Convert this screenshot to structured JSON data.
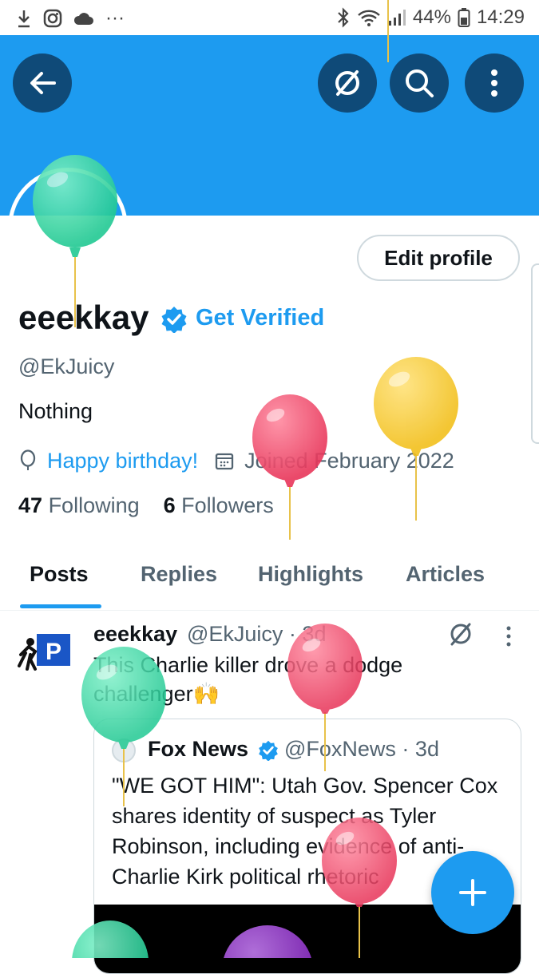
{
  "status_bar": {
    "battery": "44%",
    "time": "14:29"
  },
  "profile": {
    "name": "eeekkay",
    "get_verified": "Get Verified",
    "handle": "@EkJuicy",
    "bio": "Nothing",
    "birthday_link": "Happy birthday!",
    "joined": "Joined February 2022",
    "following_count": "47",
    "following_label": "Following",
    "followers_count": "6",
    "followers_label": "Followers",
    "edit_profile": "Edit profile"
  },
  "tabs": [
    {
      "label": "Posts",
      "active": true
    },
    {
      "label": "Replies"
    },
    {
      "label": "Highlights"
    },
    {
      "label": "Articles"
    }
  ],
  "post": {
    "author_name": "eeekkay",
    "author_handle_time": "@EkJuicy · 3d",
    "text": "This Charlie killer drove a dodge challenger🙌",
    "quote": {
      "author_name": "Fox News",
      "author_handle_time": "@FoxNews · 3d",
      "text": "\"WE GOT HIM\": Utah Gov. Spencer Cox shares identity of suspect as Tyler Robinson, including evidence of anti-Charlie Kirk political rhetoric"
    }
  },
  "colors": {
    "accent": "#1d9bf0",
    "button_dark": "#0f4a78",
    "balloon_green": "#3ddba0",
    "balloon_pink": "#f0506e",
    "balloon_yellow": "#f7d03c",
    "balloon_purple": "#9b3fd1"
  },
  "icons": [
    "download-icon",
    "instagram-icon",
    "cloud-icon",
    "more-dots-icon",
    "bluetooth-icon",
    "wifi-icon",
    "signal-icon",
    "battery-icon",
    "back-arrow-icon",
    "grok-icon",
    "search-icon",
    "vertical-more-icon",
    "verified-badge-icon",
    "balloon-location-icon",
    "calendar-icon",
    "compose-plus-icon"
  ]
}
